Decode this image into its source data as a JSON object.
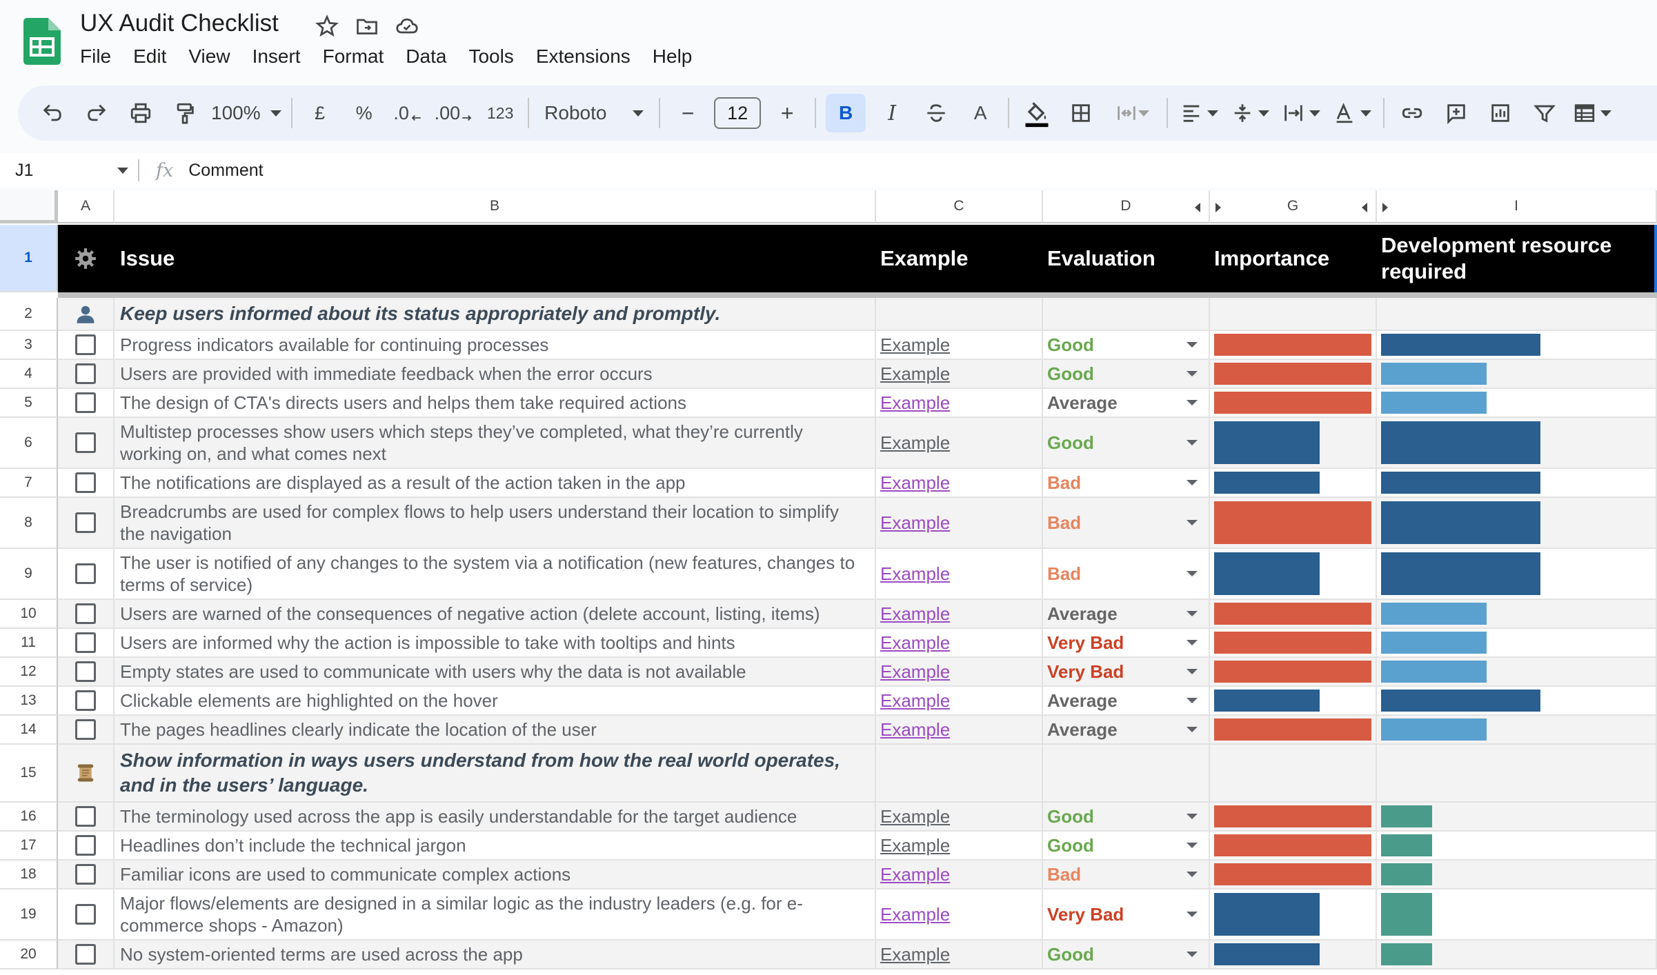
{
  "app": {
    "title": "UX Audit Checklist",
    "menu": [
      "File",
      "Edit",
      "View",
      "Insert",
      "Format",
      "Data",
      "Tools",
      "Extensions",
      "Help"
    ]
  },
  "toolbar": {
    "zoom": "100%",
    "currency": "£",
    "percent": "%",
    "dec_decrease": ".0",
    "dec_increase": ".00",
    "number_format": "123",
    "font": "Roboto",
    "font_size": "12",
    "minus": "−",
    "plus": "+",
    "bold": "B",
    "italic": "I",
    "text_color_letter": "A"
  },
  "formula_bar": {
    "cell_ref": "J1",
    "content": "Comment"
  },
  "columns": [
    "A",
    "B",
    "C",
    "D",
    "G",
    "I"
  ],
  "header": {
    "row_num": "1",
    "issue": "Issue",
    "example": "Example",
    "evaluation": "Evaluation",
    "importance": "Importance",
    "dev_resource": "Development resource required"
  },
  "colors": {
    "good": "#6aa84f",
    "average": "#666666",
    "bad": "#e6855e",
    "very_bad": "#cc4125",
    "red_bar": "#d75b43",
    "dark_blue_bar": "#2a5f8f",
    "light_blue_bar": "#5ba1cf",
    "teal_bar": "#4a9b8a",
    "link_visited": "#9c4bc1",
    "link_plain": "#5f6368"
  },
  "rows": [
    {
      "num": "2",
      "type": "section",
      "icon": "person-icon",
      "text": "Keep users informed about its status appropriately and promptly."
    },
    {
      "num": "3",
      "type": "item",
      "text": "Progress indicators available for continuing processes",
      "example": "Example",
      "link": "plain",
      "eval": "Good",
      "evalc": "good",
      "imp": "red",
      "imp_w": 1.0,
      "dev": "dark",
      "dev_w": 0.62
    },
    {
      "num": "4",
      "type": "item",
      "text": "Users are provided with immediate feedback when the error occurs",
      "example": "Example",
      "link": "plain",
      "eval": "Good",
      "evalc": "good",
      "imp": "red",
      "imp_w": 1.0,
      "dev": "light",
      "dev_w": 0.41
    },
    {
      "num": "5",
      "type": "item",
      "text": "The design of CTA's directs users and helps them take required actions",
      "example": "Example",
      "link": "visited",
      "eval": "Average",
      "evalc": "average",
      "imp": "red",
      "imp_w": 1.0,
      "dev": "light",
      "dev_w": 0.41
    },
    {
      "num": "6",
      "type": "item",
      "tall": true,
      "text": "Multistep processes show users which steps they’ve completed, what they’re currently working on, and what comes next",
      "example": "Example",
      "link": "plain",
      "eval": "Good",
      "evalc": "good",
      "imp": "dark",
      "imp_w": 0.67,
      "dev": "dark",
      "dev_w": 0.62
    },
    {
      "num": "7",
      "type": "item",
      "text": "The notifications are displayed as a result of the action taken in the app",
      "example": "Example",
      "link": "visited",
      "eval": "Bad",
      "evalc": "bad",
      "imp": "dark",
      "imp_w": 0.67,
      "dev": "dark",
      "dev_w": 0.62
    },
    {
      "num": "8",
      "type": "item",
      "tall": true,
      "text": "Breadcrumbs are used for complex flows to help users understand their location to simplify the navigation",
      "example": "Example",
      "link": "visited",
      "eval": "Bad",
      "evalc": "bad",
      "imp": "red",
      "imp_w": 1.0,
      "dev": "dark",
      "dev_w": 0.62
    },
    {
      "num": "9",
      "type": "item",
      "tall": true,
      "text": "The user is notified of any changes to the system via a notification (new features, changes to terms of service)",
      "example": "Example",
      "link": "visited",
      "eval": "Bad",
      "evalc": "bad",
      "imp": "dark",
      "imp_w": 0.67,
      "dev": "dark",
      "dev_w": 0.62
    },
    {
      "num": "10",
      "type": "item",
      "text": "Users are warned of the consequences of negative action (delete account, listing, items)",
      "example": "Example",
      "link": "visited",
      "eval": "Average",
      "evalc": "average",
      "imp": "red",
      "imp_w": 1.0,
      "dev": "light",
      "dev_w": 0.41
    },
    {
      "num": "11",
      "type": "item",
      "text": "Users are informed why the action is impossible to take with tooltips and hints",
      "example": "Example",
      "link": "visited",
      "eval": "Very Bad",
      "evalc": "very_bad",
      "imp": "red",
      "imp_w": 1.0,
      "dev": "light",
      "dev_w": 0.41
    },
    {
      "num": "12",
      "type": "item",
      "text": "Empty states are used to communicate with users why the data is not available",
      "example": "Example",
      "link": "visited",
      "eval": "Very Bad",
      "evalc": "very_bad",
      "imp": "red",
      "imp_w": 1.0,
      "dev": "light",
      "dev_w": 0.41
    },
    {
      "num": "13",
      "type": "item",
      "text": "Clickable elements are highlighted on the hover",
      "example": "Example",
      "link": "visited",
      "eval": "Average",
      "evalc": "average",
      "imp": "dark",
      "imp_w": 0.67,
      "dev": "dark",
      "dev_w": 0.62
    },
    {
      "num": "14",
      "type": "item",
      "text": "The pages headlines clearly indicate the location of the user",
      "example": "Example",
      "link": "visited",
      "eval": "Average",
      "evalc": "average",
      "imp": "red",
      "imp_w": 1.0,
      "dev": "light",
      "dev_w": 0.41
    },
    {
      "num": "15",
      "type": "section",
      "tall": true,
      "icon": "scroll-icon",
      "text": "Show information in ways users understand from how the real world operates, and in the users’ language."
    },
    {
      "num": "16",
      "type": "item",
      "text": "The terminology used across the app is easily understandable for the target audience",
      "example": "Example",
      "link": "plain",
      "eval": "Good",
      "evalc": "good",
      "imp": "red",
      "imp_w": 1.0,
      "dev": "teal",
      "dev_w": 0.2
    },
    {
      "num": "17",
      "type": "item",
      "text": "Headlines don’t include the technical jargon",
      "example": "Example",
      "link": "plain",
      "eval": "Good",
      "evalc": "good",
      "imp": "red",
      "imp_w": 1.0,
      "dev": "teal",
      "dev_w": 0.2
    },
    {
      "num": "18",
      "type": "item",
      "text": "Familiar icons are used to communicate complex actions",
      "example": "Example",
      "link": "visited",
      "eval": "Bad",
      "evalc": "bad",
      "imp": "red",
      "imp_w": 1.0,
      "dev": "teal",
      "dev_w": 0.2
    },
    {
      "num": "19",
      "type": "item",
      "tall": true,
      "text": "Major flows/elements are designed in a similar logic as the industry leaders (e.g. for e-commerce shops - Amazon)",
      "example": "Example",
      "link": "visited",
      "eval": "Very Bad",
      "evalc": "very_bad",
      "imp": "dark",
      "imp_w": 0.67,
      "dev": "teal",
      "dev_w": 0.2
    },
    {
      "num": "20",
      "type": "item",
      "text": "No system-oriented terms are used across the app",
      "example": "Example",
      "link": "plain",
      "eval": "Good",
      "evalc": "good",
      "imp": "dark",
      "imp_w": 0.67,
      "dev": "teal",
      "dev_w": 0.2
    }
  ]
}
